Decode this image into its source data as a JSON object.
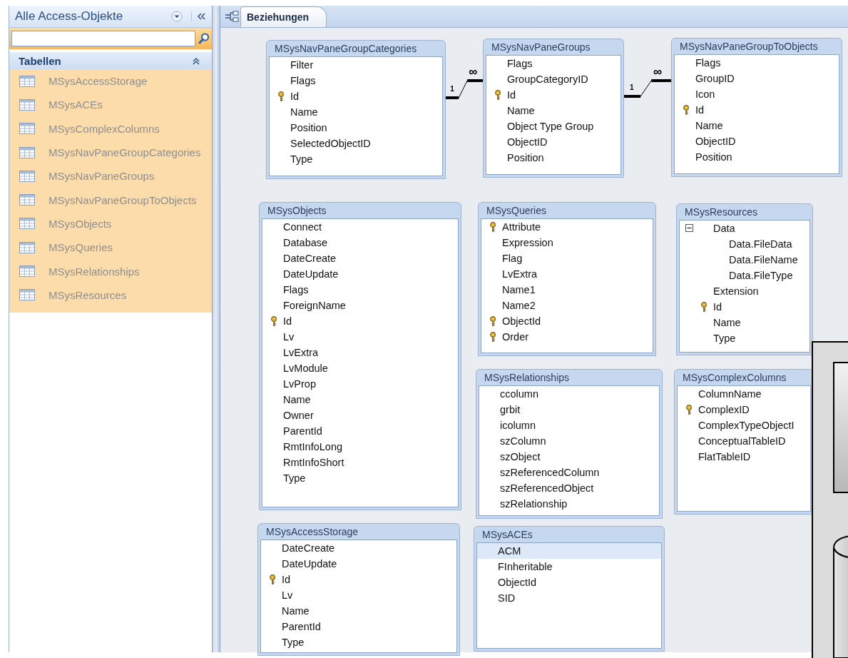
{
  "nav_pane": {
    "title": "Alle Access-Objekte",
    "group": {
      "label": "Tabellen",
      "expanded": true
    },
    "items": [
      {
        "label": "MSysAccessStorage",
        "dimmed": true
      },
      {
        "label": "MSysACEs",
        "dimmed": true
      },
      {
        "label": "MSysComplexColumns",
        "dimmed": true
      },
      {
        "label": "MSysNavPaneGroupCategories",
        "dimmed": true
      },
      {
        "label": "MSysNavPaneGroups",
        "dimmed": true
      },
      {
        "label": "MSysNavPaneGroupToObjects",
        "dimmed": true
      },
      {
        "label": "MSysObjects",
        "dimmed": true
      },
      {
        "label": "MSysQueries",
        "dimmed": true
      },
      {
        "label": "MSysRelationships",
        "dimmed": true
      },
      {
        "label": "MSysResources",
        "dimmed": true
      }
    ]
  },
  "tabs": [
    {
      "label": "Beziehungen",
      "selected": true
    }
  ],
  "tables": [
    {
      "title": "MSysNavPaneGroupCategories",
      "fields": [
        {
          "name": "Filter",
          "key": false,
          "selected": false
        },
        {
          "name": "Flags",
          "key": false,
          "selected": false
        },
        {
          "name": "Id",
          "key": true,
          "selected": false
        },
        {
          "name": "Name",
          "key": false,
          "selected": false
        },
        {
          "name": "Position",
          "key": false,
          "selected": false
        },
        {
          "name": "SelectedObjectID",
          "key": false,
          "selected": false
        },
        {
          "name": "Type",
          "key": false,
          "selected": false
        }
      ]
    },
    {
      "title": "MSysNavPaneGroups",
      "fields": [
        {
          "name": "Flags",
          "key": false,
          "selected": false
        },
        {
          "name": "GroupCategoryID",
          "key": false,
          "selected": false
        },
        {
          "name": "Id",
          "key": true,
          "selected": false
        },
        {
          "name": "Name",
          "key": false,
          "selected": false
        },
        {
          "name": "Object Type Group",
          "key": false,
          "selected": false
        },
        {
          "name": "ObjectID",
          "key": false,
          "selected": false
        },
        {
          "name": "Position",
          "key": false,
          "selected": false
        }
      ]
    },
    {
      "title": "MSysNavPaneGroupToObjects",
      "fields": [
        {
          "name": "Flags",
          "key": false,
          "selected": false
        },
        {
          "name": "GroupID",
          "key": false,
          "selected": false
        },
        {
          "name": "Icon",
          "key": false,
          "selected": false
        },
        {
          "name": "Id",
          "key": true,
          "selected": false
        },
        {
          "name": "Name",
          "key": false,
          "selected": false
        },
        {
          "name": "ObjectID",
          "key": false,
          "selected": false
        },
        {
          "name": "Position",
          "key": false,
          "selected": false
        }
      ]
    },
    {
      "title": "MSysObjects",
      "fields": [
        {
          "name": "Connect",
          "key": false,
          "selected": false
        },
        {
          "name": "Database",
          "key": false,
          "selected": false
        },
        {
          "name": "DateCreate",
          "key": false,
          "selected": false
        },
        {
          "name": "DateUpdate",
          "key": false,
          "selected": false
        },
        {
          "name": "Flags",
          "key": false,
          "selected": false
        },
        {
          "name": "ForeignName",
          "key": false,
          "selected": false
        },
        {
          "name": "Id",
          "key": true,
          "selected": false
        },
        {
          "name": "Lv",
          "key": false,
          "selected": false
        },
        {
          "name": "LvExtra",
          "key": false,
          "selected": false
        },
        {
          "name": "LvModule",
          "key": false,
          "selected": false
        },
        {
          "name": "LvProp",
          "key": false,
          "selected": false
        },
        {
          "name": "Name",
          "key": false,
          "selected": false
        },
        {
          "name": "Owner",
          "key": false,
          "selected": false
        },
        {
          "name": "ParentId",
          "key": false,
          "selected": false
        },
        {
          "name": "RmtInfoLong",
          "key": false,
          "selected": false
        },
        {
          "name": "RmtInfoShort",
          "key": false,
          "selected": false
        },
        {
          "name": "Type",
          "key": false,
          "selected": false
        }
      ]
    },
    {
      "title": "MSysQueries",
      "fields": [
        {
          "name": "Attribute",
          "key": true,
          "selected": false
        },
        {
          "name": "Expression",
          "key": false,
          "selected": false
        },
        {
          "name": "Flag",
          "key": false,
          "selected": false
        },
        {
          "name": "LvExtra",
          "key": false,
          "selected": false
        },
        {
          "name": "Name1",
          "key": false,
          "selected": false
        },
        {
          "name": "Name2",
          "key": false,
          "selected": false
        },
        {
          "name": "ObjectId",
          "key": true,
          "selected": false
        },
        {
          "name": "Order",
          "key": true,
          "selected": false
        }
      ]
    },
    {
      "title": "MSysResources",
      "fields": [
        {
          "name": "Data",
          "key": false,
          "selected": false,
          "expanded": true,
          "children": [
            {
              "name": "Data.FileData",
              "key": false,
              "selected": false
            },
            {
              "name": "Data.FileName",
              "key": false,
              "selected": false
            },
            {
              "name": "Data.FileType",
              "key": false,
              "selected": false
            }
          ]
        },
        {
          "name": "Extension",
          "key": false,
          "selected": false
        },
        {
          "name": "Id",
          "key": true,
          "selected": false
        },
        {
          "name": "Name",
          "key": false,
          "selected": false
        },
        {
          "name": "Type",
          "key": false,
          "selected": false
        }
      ]
    },
    {
      "title": "MSysRelationships",
      "fields": [
        {
          "name": "ccolumn",
          "key": false,
          "selected": false
        },
        {
          "name": "grbit",
          "key": false,
          "selected": false
        },
        {
          "name": "icolumn",
          "key": false,
          "selected": false
        },
        {
          "name": "szColumn",
          "key": false,
          "selected": false
        },
        {
          "name": "szObject",
          "key": false,
          "selected": false
        },
        {
          "name": "szReferencedColumn",
          "key": false,
          "selected": false
        },
        {
          "name": "szReferencedObject",
          "key": false,
          "selected": false
        },
        {
          "name": "szRelationship",
          "key": false,
          "selected": false
        }
      ]
    },
    {
      "title": "MSysComplexColumns",
      "fields": [
        {
          "name": "ColumnName",
          "key": false,
          "selected": false
        },
        {
          "name": "ComplexID",
          "key": true,
          "selected": false
        },
        {
          "name": "ComplexTypeObjectI",
          "key": false,
          "selected": false
        },
        {
          "name": "ConceptualTableID",
          "key": false,
          "selected": false
        },
        {
          "name": "FlatTableID",
          "key": false,
          "selected": false
        }
      ]
    },
    {
      "title": "MSysAccessStorage",
      "fields": [
        {
          "name": "DateCreate",
          "key": false,
          "selected": false
        },
        {
          "name": "DateUpdate",
          "key": false,
          "selected": false
        },
        {
          "name": "Id",
          "key": true,
          "selected": false
        },
        {
          "name": "Lv",
          "key": false,
          "selected": false
        },
        {
          "name": "Name",
          "key": false,
          "selected": false
        },
        {
          "name": "ParentId",
          "key": false,
          "selected": false
        },
        {
          "name": "Type",
          "key": false,
          "selected": false
        }
      ]
    },
    {
      "title": "MSysACEs",
      "fields": [
        {
          "name": "ACM",
          "key": false,
          "selected": true
        },
        {
          "name": "FInheritable",
          "key": false,
          "selected": false
        },
        {
          "name": "ObjectId",
          "key": false,
          "selected": false
        },
        {
          "name": "SID",
          "key": false,
          "selected": false
        }
      ]
    }
  ],
  "relationships": [
    {
      "from_label": "1",
      "to_label": "∞"
    },
    {
      "from_label": "1",
      "to_label": "∞"
    }
  ]
}
